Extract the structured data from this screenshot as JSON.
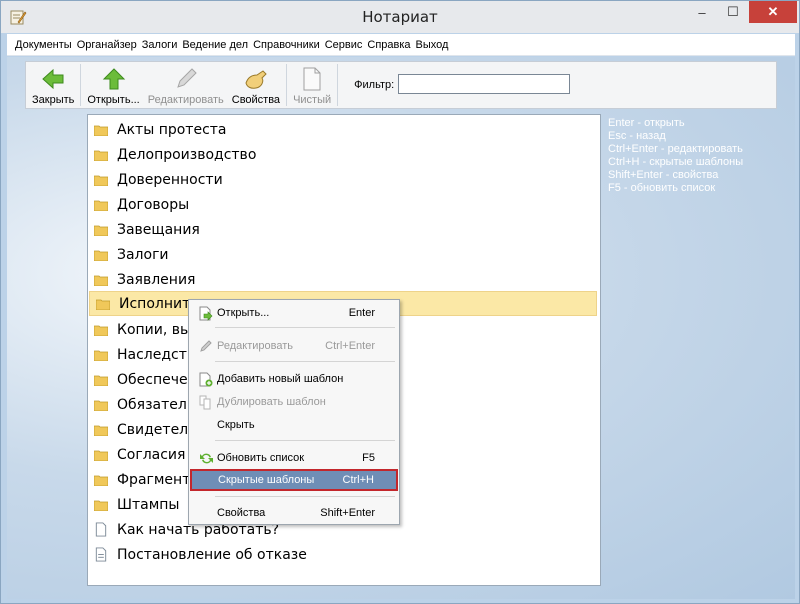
{
  "window": {
    "title": "Нотариат",
    "minimize": "–",
    "maximize": "☐",
    "close": "✕"
  },
  "menu": [
    "Документы",
    "Органайзер",
    "Залоги",
    "Ведение дел",
    "Справочники",
    "Сервис",
    "Справка",
    "Выход"
  ],
  "toolbar": {
    "close_label": "Закрыть",
    "open_label": "Открыть...",
    "edit_label": "Редактировать",
    "props_label": "Свойства",
    "clean_label": "Чистый",
    "filter_label": "Фильтр:",
    "filter_value": ""
  },
  "list": [
    "Акты протеста",
    "Делопроизводство",
    "Доверенности",
    "Договоры",
    "Завещания",
    "Залоги",
    "Заявления",
    "Исполнител",
    "Копии, вып",
    "Наследств",
    "Обеспечен",
    "Обязатель",
    "Свидетельс",
    "Согласия",
    "Фрагменты",
    "Штампы",
    "Как начать работать?",
    "Постановление об отказе"
  ],
  "hints": [
    "Enter - открыть",
    "Esc - назад",
    "Ctrl+Enter - редактировать",
    "Ctrl+H - скрытые шаблоны",
    "Shift+Enter - свойства",
    "F5 - обновить список"
  ],
  "context_menu": {
    "open": {
      "label": "Открыть...",
      "shortcut": "Enter"
    },
    "edit": {
      "label": "Редактировать",
      "shortcut": "Ctrl+Enter"
    },
    "add": {
      "label": "Добавить новый шаблон"
    },
    "dup": {
      "label": "Дублировать шаблон"
    },
    "hide": {
      "label": "Скрыть"
    },
    "refresh": {
      "label": "Обновить список",
      "shortcut": "F5"
    },
    "hidden": {
      "label": "Скрытые шаблоны",
      "shortcut": "Ctrl+H"
    },
    "props": {
      "label": "Свойства",
      "shortcut": "Shift+Enter"
    }
  },
  "colors": {
    "accent_green": "#5fb030",
    "selection": "#fbe8a6",
    "menu_highlight": "#6f8eb6",
    "highlight_border": "#c3272c"
  }
}
